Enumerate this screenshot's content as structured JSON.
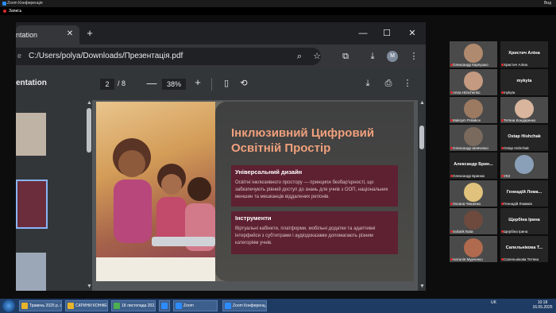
{
  "zoom": {
    "window_title": "Zoom Конференція",
    "view_label": "Вид",
    "recording_label": "Запись"
  },
  "chrome": {
    "tab_title": "ntation",
    "tab_close": "✕",
    "new_tab": "+",
    "minimize": "—",
    "maximize": "☐",
    "close": "✕",
    "url": "C:/Users/polya/Downloads/Презентація.pdf",
    "avatar_letter": "M"
  },
  "pdf": {
    "title": "entation",
    "current_page": "2",
    "total_pages": "/ 8",
    "zoom_level": "38%",
    "zoom_minus": "—",
    "zoom_plus": "+"
  },
  "slide": {
    "title": "Інклюзивний Цифровий Освітній Простір",
    "cards": [
      {
        "heading": "Універсальний дизайн",
        "body": "Освітні інклюзивного простору — принципи безбар'єрності, що забезпечують рівний доступ до знань для учнів з ООП, національних меншин та мешканців віддалених регіонів."
      },
      {
        "heading": "Інструменти",
        "body": "Віртуальні кабінети, платформи, мобільні додатки та адаптивні інтерфейси з субтитрами і аудіодоказами допомагають різним категоріям учнів."
      }
    ]
  },
  "participants": [
    {
      "name": "Олександр Карпушко",
      "big": "",
      "type": "video",
      "face": "#b08a6e"
    },
    {
      "name": "Христич Аліна",
      "big": "Христич Аліна",
      "type": "name"
    },
    {
      "name": "Anna Hrinchenko",
      "big": "",
      "type": "video",
      "face": "#c49a80"
    },
    {
      "name": "mykyta",
      "big": "mykyta",
      "type": "name"
    },
    {
      "name": "Maksym Poliakov",
      "big": "",
      "type": "video",
      "face": "#9c7a62"
    },
    {
      "name": "Тетяна Кондаренко",
      "big": "",
      "type": "video",
      "face": "#d8b59c"
    },
    {
      "name": "Олександр Шевченко",
      "big": "",
      "type": "video",
      "face": "#7a6a5e"
    },
    {
      "name": "Ostap Hishchak",
      "big": "Ostap Hishchak",
      "type": "name"
    },
    {
      "name": "Олександр Бринюк",
      "big": "Александр Брин...",
      "type": "name"
    },
    {
      "name": "УКЗ",
      "big": "",
      "type": "video",
      "face": "#8aa0b8"
    },
    {
      "name": "Оксана Чешенко",
      "big": "",
      "type": "video",
      "face": "#e0c27c"
    },
    {
      "name": "Геннадій Ломакін",
      "big": "Геннадій Лома...",
      "type": "name"
    },
    {
      "name": "Soliarik Nata",
      "big": "",
      "type": "video",
      "face": "#6e4a3e"
    },
    {
      "name": "Щербіна Ірина",
      "big": "Щербіна Ірина",
      "type": "name"
    },
    {
      "name": "Наталія Мурченко",
      "big": "",
      "type": "video",
      "face": "#b06a4e"
    },
    {
      "name": "Сапельнікова Тетяна",
      "big": "Сапельнікова Т...",
      "type": "name"
    }
  ],
  "taskbar": {
    "items": [
      {
        "label": "Травень 2025 р. з...",
        "color": "#e8b42a"
      },
      {
        "label": "СКРИНИ КОНФЕР...",
        "color": "#e8b42a"
      },
      {
        "label": "18 листопада 202...",
        "color": "#4caf50"
      },
      {
        "label": "",
        "color": "#2d8cff"
      },
      {
        "label": "Zoom",
        "color": "#2d8cff"
      },
      {
        "label": "Zoom Конференц...",
        "color": "#2d8cff"
      }
    ],
    "lang": "UK",
    "time": "10:18",
    "date": "16.05.2025"
  }
}
